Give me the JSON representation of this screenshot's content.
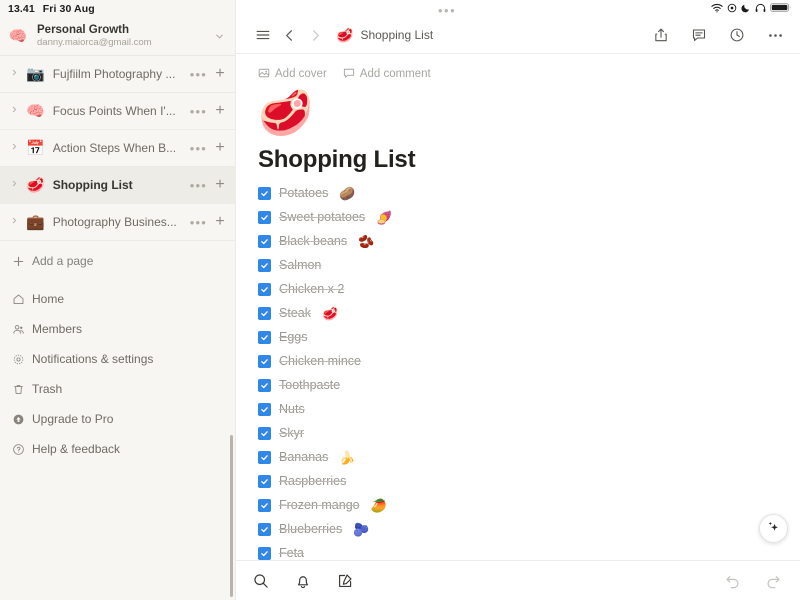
{
  "status_bar": {
    "time": "13.41",
    "date": "Fri 30 Aug",
    "icons": [
      "wifi-icon",
      "record-icon",
      "do-not-disturb-icon",
      "headphones-icon",
      "battery-icon"
    ]
  },
  "sidebar": {
    "workspace": {
      "avatar_emoji": "🧠",
      "name": "Personal Growth",
      "email": "danny.maiorca@gmail.com",
      "chevron_icon": "chevron-down-icon"
    },
    "pages": [
      {
        "emoji": "📷",
        "label": "Fujfiilm Photography ...",
        "selected": false
      },
      {
        "emoji": "🧠",
        "label": "Focus Points When I'...",
        "selected": false
      },
      {
        "emoji": "📅",
        "label": "Action Steps When B...",
        "selected": false
      },
      {
        "emoji": "🥩",
        "label": "Shopping List",
        "selected": true
      },
      {
        "emoji": "💼",
        "label": "Photography Busines...",
        "selected": false
      }
    ],
    "add_page_label": "Add a page",
    "menu": [
      {
        "icon": "home-icon",
        "label": "Home"
      },
      {
        "icon": "members-icon",
        "label": "Members"
      },
      {
        "icon": "gear-icon",
        "label": "Notifications & settings"
      },
      {
        "icon": "trash-icon",
        "label": "Trash"
      },
      {
        "icon": "upgrade-icon",
        "label": "Upgrade to Pro"
      },
      {
        "icon": "help-icon",
        "label": "Help & feedback"
      }
    ]
  },
  "toolbar": {
    "menu_icon": "hamburger-icon",
    "back_icon": "chevron-left-icon",
    "forward_icon": "chevron-right-icon",
    "breadcrumb_emoji": "🥩",
    "breadcrumb_label": "Shopping List",
    "share_icon": "share-icon",
    "comment_icon": "comment-icon",
    "history_icon": "clock-icon",
    "more_icon": "more-horizontal-icon"
  },
  "page": {
    "add_cover_label": "Add cover",
    "add_comment_label": "Add comment",
    "emoji": "🥩",
    "title": "Shopping List",
    "todos": [
      {
        "text": "Potatoes",
        "emoji": "🥔",
        "checked": true
      },
      {
        "text": "Sweet potatoes",
        "emoji": "🍠",
        "checked": true
      },
      {
        "text": "Black beans",
        "emoji": "🫘",
        "checked": true
      },
      {
        "text": "Salmon",
        "emoji": "",
        "checked": true
      },
      {
        "text": "Chicken x 2",
        "emoji": "",
        "checked": true
      },
      {
        "text": "Steak",
        "emoji": "🥩",
        "checked": true
      },
      {
        "text": "Eggs",
        "emoji": "",
        "checked": true
      },
      {
        "text": "Chicken mince",
        "emoji": "",
        "checked": true
      },
      {
        "text": "Toothpaste",
        "emoji": "",
        "checked": true
      },
      {
        "text": "Nuts",
        "emoji": "",
        "checked": true
      },
      {
        "text": "Skyr",
        "emoji": "",
        "checked": true
      },
      {
        "text": "Bananas",
        "emoji": "🍌",
        "checked": true
      },
      {
        "text": "Raspberries",
        "emoji": "",
        "checked": true
      },
      {
        "text": "Frozen mango",
        "emoji": "🥭",
        "checked": true
      },
      {
        "text": "Blueberries",
        "emoji": "🫐",
        "checked": true
      },
      {
        "text": "Feta",
        "emoji": "",
        "checked": true
      }
    ],
    "ai_button_icon": "sparkle-icon"
  },
  "bottom_bar": {
    "search_icon": "search-icon",
    "notifications_icon": "bell-icon",
    "new_page_icon": "compose-icon",
    "undo_icon": "undo-icon",
    "redo_icon": "redo-icon"
  },
  "colors": {
    "checkbox_blue": "#2f87e8",
    "sidebar_bg": "#f7f6f3",
    "selected_row_bg": "#eeece7",
    "text_primary": "#37352f",
    "text_muted": "#9b9892"
  }
}
